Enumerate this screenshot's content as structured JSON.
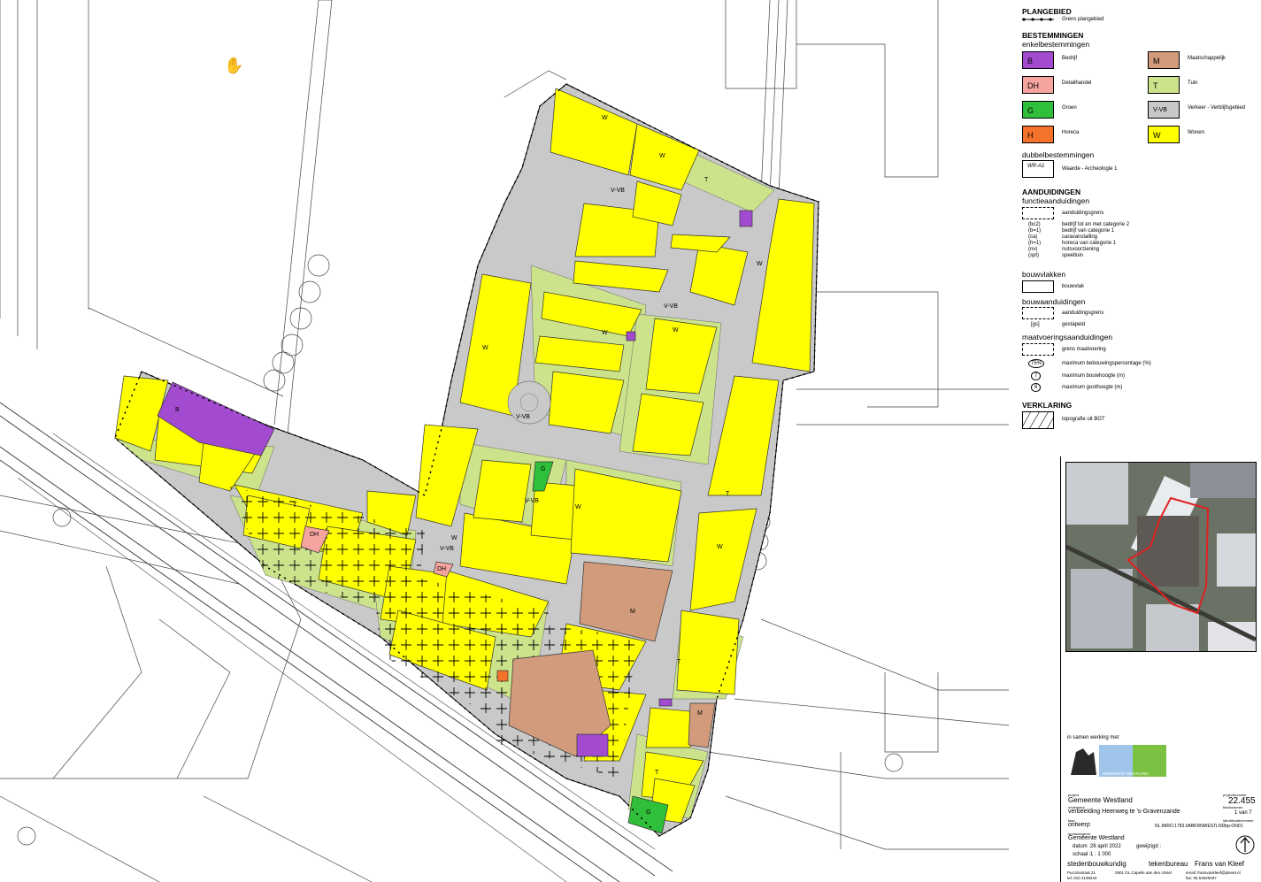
{
  "legend": {
    "plangebied": {
      "heading": "PLANGEBIED",
      "item": "Grens plangebied"
    },
    "bestemmingen": {
      "heading": "BESTEMMINGEN",
      "subheading": "enkelbestemmingen",
      "items": [
        {
          "code": "B",
          "label": "Bedrijf",
          "color": "#a24bd1"
        },
        {
          "code": "M",
          "label": "Maatschappelijk",
          "color": "#d19b7c"
        },
        {
          "code": "DH",
          "label": "Detailhandel",
          "color": "#f6a4a0"
        },
        {
          "code": "T",
          "label": "Tuin",
          "color": "#cce38c"
        },
        {
          "code": "G",
          "label": "Groen",
          "color": "#2fbf3a"
        },
        {
          "code": "V-VB",
          "label": "Verkeer - Verblijfsgebied",
          "color": "#c8c8c8"
        },
        {
          "code": "H",
          "label": "Horeca",
          "color": "#f5722a"
        },
        {
          "code": "W",
          "label": "Wonen",
          "color": "#ffff00"
        }
      ]
    },
    "dubbel": {
      "heading": "dubbelbestemmingen",
      "code": "WR-A1",
      "label": "Waarde - Archeologie 1"
    },
    "aanduidingen": {
      "heading": "AANDUIDINGEN",
      "subheading": "functieaanduidingen",
      "grens": "aanduidingsgrens",
      "items": [
        {
          "code": "(bc2)",
          "label": "bedrijf tot en met categorie 2"
        },
        {
          "code": "(b=1)",
          "label": "bedrijf van categorie 1"
        },
        {
          "code": "(ca)",
          "label": "caravanstalling"
        },
        {
          "code": "(h=1)",
          "label": "horeca van categorie 1"
        },
        {
          "code": "(nv)",
          "label": "nutsvoorziening"
        },
        {
          "code": "(spt)",
          "label": "speeltuin"
        }
      ]
    },
    "bouwvlakken": {
      "heading": "bouwvlakken",
      "item": "bouwvlak"
    },
    "bouwaanduidingen": {
      "heading": "bouwaanduidingen",
      "grens": "aanduidingsgrens",
      "code": "[gs]",
      "item": "gestapeld"
    },
    "maatvoering": {
      "heading": "maatvoeringsaanduidingen",
      "grens": "grens maatvoering",
      "items": [
        {
          "code": "75%",
          "label": "maximum bebouwingspercentage (%)"
        },
        {
          "code": "7",
          "label": "maximum bouwhoogte (m)"
        },
        {
          "code": "6",
          "label": "maximum goothoogte (m)"
        }
      ]
    },
    "verklaring": {
      "heading": "VERKLARING",
      "item": "topografie uit BGT"
    }
  },
  "map_labels": {
    "wonen": "W",
    "verkeer": "V-VB",
    "tuin": "T",
    "maatschappelijk": "M",
    "groen": "G",
    "bedrijf": "B",
    "detailhandel": "DH",
    "wr": "WR-A1"
  },
  "titleblock": {
    "cooperation": "in samen werking met",
    "logo_text": "GEMEENTE WESTLAND",
    "project_label": "project",
    "project": "Gemeente Westland",
    "projectnummer_label": "projectnummer",
    "projectnummer": "22.455",
    "onderwerp_label": "onderwerp",
    "onderwerp": "verbeelding Heenweg te 's-Gravenzande",
    "blad_label": "bladnummer",
    "blad": "1 van 7",
    "fase_label": "fase",
    "fase": "ontwerp",
    "ident_label": "identificatienummer",
    "ident": "NL.IMRO.1783.0ABKRNWESTLNDbp-ON01",
    "opdrachtgever_label": "opdrachtgever",
    "opdrachtgever": "Gemeente Westland",
    "datum_label": "datum :",
    "datum": "26 april 2022",
    "gewijzigd_label": "gewijzigd :",
    "schaal_label": "schaal :",
    "schaal": "1 : 1 000",
    "office1": "stedenbouwkundig",
    "office2": "tekenbureau",
    "office3": "Frans van Kleef",
    "address1": "Puccinistraat 21",
    "address2": "2901 GL Capelle aan den IJssel",
    "email": "email: fransvankleef@planet.nl",
    "tel": "tel: 010 4139442",
    "fax": "fax: 06 54029187"
  }
}
